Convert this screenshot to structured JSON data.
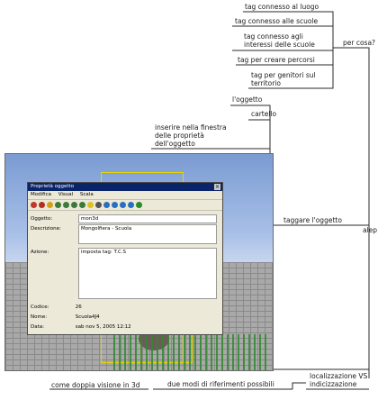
{
  "branches": {
    "luogo": "tag connesso al luogo",
    "scuole": "tag connesso alle scuole",
    "interessi_1": "tag connesso agli",
    "interessi_2": "interessi delle scuole",
    "percorsi": "tag per creare percorsi",
    "genitori_1": "tag per genitori sul",
    "genitori_2": "territorio",
    "per_cosa": "per cosa?",
    "oggetto": "l'oggetto",
    "cartello": "cartello",
    "inserire_1": "inserire nella finestra",
    "inserire_2": "delle proprietà",
    "inserire_3": "dell'oggetto",
    "taggare": "taggare l'oggetto",
    "alep": "alep",
    "localizzazione_1": "localizzazione VS",
    "localizzazione_2": "indicizzazione",
    "due_modi": "due modi di riferimenti possibili",
    "doppia_visione": "come doppia visione in 3d"
  },
  "screenshot": {
    "dialog_title": "Proprietà oggetto",
    "menu": [
      "Modifica",
      "Visual",
      "Scala"
    ],
    "fields": [
      {
        "label": "Oggetto:",
        "value": "mon3d"
      },
      {
        "label": "Descrizione:",
        "value": "Mongolfiera - Scuola"
      },
      {
        "label": "Azione:",
        "value": "imposta tag: T.C.S"
      },
      {
        "label": "Codice:",
        "value": "26"
      },
      {
        "label": "Nome:",
        "value": "Scuola4J4"
      },
      {
        "label": "Data:",
        "value": "sab nov 5, 2005 12:12"
      }
    ]
  },
  "colors": {
    "line": "#2a2a2a"
  }
}
